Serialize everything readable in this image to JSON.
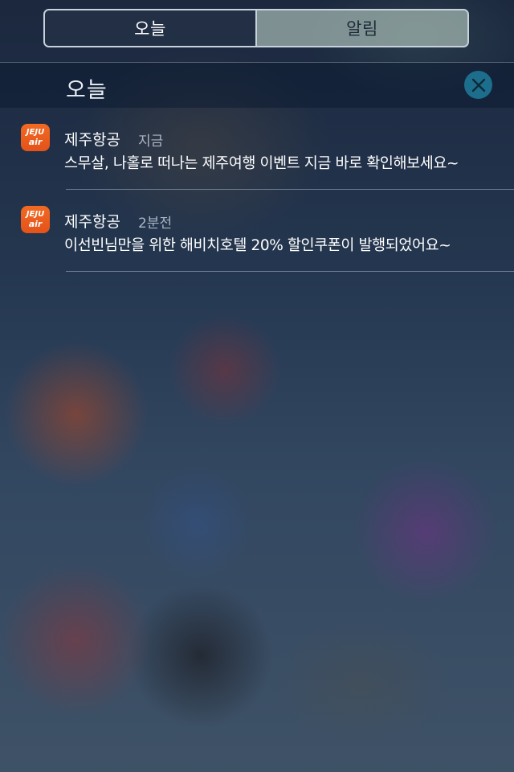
{
  "segmented": {
    "today_label": "오늘",
    "notifications_label": "알림",
    "selected": "알림"
  },
  "section": {
    "title": "오늘",
    "clear_icon": "close-icon"
  },
  "notifications": [
    {
      "app_name": "제주항공",
      "app_icon_text_1": "JEJU",
      "app_icon_text_2": "air",
      "time": "지금",
      "message": "스무살, 나홀로 떠나는 제주여행 이벤트 지금 바로  확인해보세요~"
    },
    {
      "app_name": "제주항공",
      "app_icon_text_1": "JEJU",
      "app_icon_text_2": "air",
      "time": "2분전",
      "message": "이선빈님만을 위한 해비치호텔 20% 할인쿠폰이 발행되었어요~"
    }
  ],
  "colors": {
    "app_icon": "#f26a22",
    "clear_button": "#1c6e8c"
  }
}
